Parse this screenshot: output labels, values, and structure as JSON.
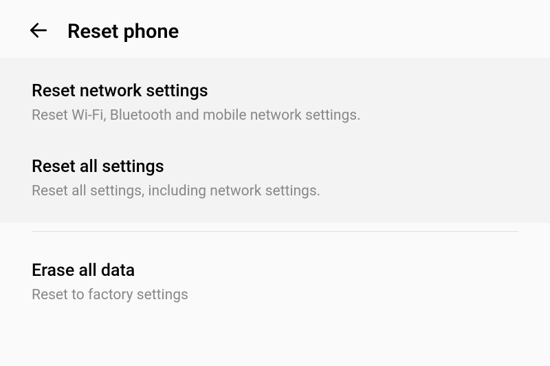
{
  "header": {
    "title": "Reset phone"
  },
  "options": {
    "network": {
      "title": "Reset network settings",
      "description": "Reset Wi-Fi, Bluetooth and mobile network settings."
    },
    "all": {
      "title": "Reset all settings",
      "description": "Reset all settings, including network settings."
    },
    "erase": {
      "title": "Erase all data",
      "description": "Reset to factory settings"
    }
  }
}
